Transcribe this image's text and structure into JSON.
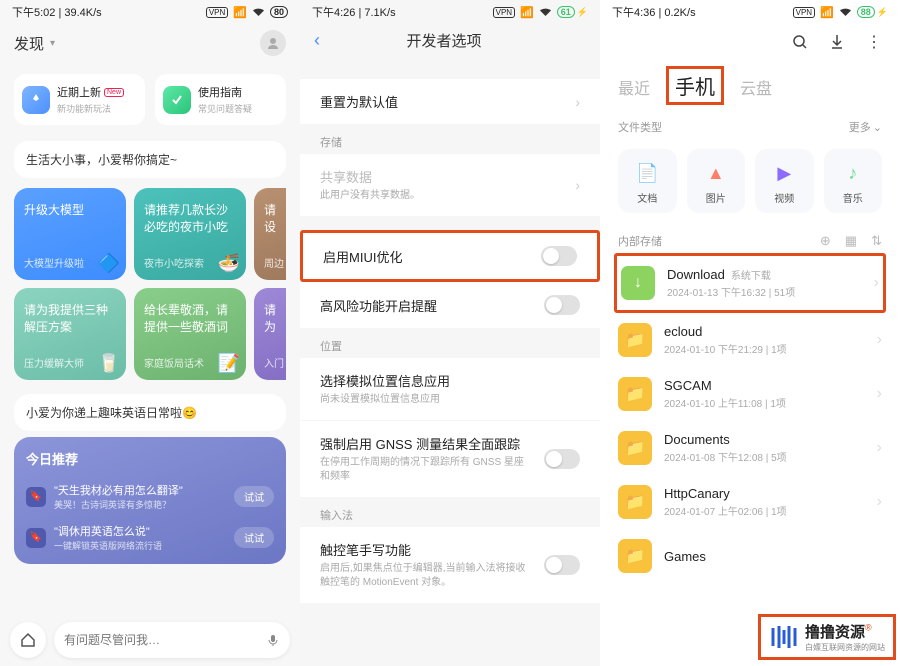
{
  "p1": {
    "status_time": "下午5:02 | 39.4K/s",
    "battery": "80",
    "title": "发现",
    "card_new": {
      "title": "近期上新",
      "badge": "New",
      "sub": "新功能新玩法"
    },
    "card_guide": {
      "title": "使用指南",
      "sub": "常见问题答疑"
    },
    "suggest": "生活大小事，小爱帮你搞定~",
    "tiles": [
      {
        "t": "升级大模型",
        "f": "大模型升级啦"
      },
      {
        "t": "请推荐几款长沙必吃的夜市小吃",
        "f": "夜市小吃探索"
      },
      {
        "t": "请设",
        "f": "周边"
      },
      {
        "t": "请为我提供三种解压方案",
        "f": "压力缓解大师"
      },
      {
        "t": "给长辈敬酒，请提供一些敬酒词",
        "f": "家庭饭局话术"
      },
      {
        "t": "请为",
        "f": "入门"
      }
    ],
    "suggest2": "小爱为你递上趣味英语日常啦😊",
    "today": {
      "h": "今日推荐",
      "rows": [
        {
          "a": "\"天生我材必有用怎么翻译\"",
          "b": "美哭！古诗词英译有多惊艳？",
          "btn": "试试"
        },
        {
          "a": "\"调休用英语怎么说\"",
          "b": "一键解锁英语版网络流行语",
          "btn": "试试"
        }
      ]
    },
    "search_ph": "有问题尽管问我…"
  },
  "p2": {
    "status_time": "下午4:26 | 7.1K/s",
    "battery": "61",
    "title": "开发者选项",
    "reset": "重置为默认值",
    "g_store": "存储",
    "r_share": {
      "a": "共享数据",
      "b": "此用户没有共享数据。"
    },
    "r_miui": "启用MIUI优化",
    "r_risk": "高风险功能开启提醒",
    "g_loc": "位置",
    "r_loc": {
      "a": "选择模拟位置信息应用",
      "b": "尚未设置模拟位置信息应用"
    },
    "r_gnss": {
      "a": "强制启用 GNSS 测量结果全面跟踪",
      "b": "在停用工作周期的情况下跟踪所有 GNSS 星座和频率"
    },
    "g_ime": "输入法",
    "r_pen": {
      "a": "触控笔手写功能",
      "b": "启用后,如果焦点位于编辑器,当前输入法将接收触控笔的 MotionEvent 对象。"
    }
  },
  "p3": {
    "status_time": "下午4:36 | 0.2K/s",
    "battery": "88",
    "tabs": {
      "a": "最近",
      "b": "手机",
      "c": "云盘"
    },
    "ftype_lbl": "文件类型",
    "more": "更多",
    "cats": [
      {
        "l": "文档"
      },
      {
        "l": "图片"
      },
      {
        "l": "视频"
      },
      {
        "l": "音乐"
      }
    ],
    "storage": "内部存储",
    "folders": [
      {
        "n": "Download",
        "sys": "系统下载",
        "d": "2024-01-13 下午16:32 | 51项"
      },
      {
        "n": "ecloud",
        "d": "2024-01-10 下午21:29 | 1项"
      },
      {
        "n": "SGCAM",
        "d": "2024-01-10 上午11:08 | 1项"
      },
      {
        "n": "Documents",
        "d": "2024-01-08 下午12:08 | 5项"
      },
      {
        "n": "HttpCanary",
        "d": "2024-01-07 上午02:06 | 1项"
      },
      {
        "n": "Games",
        "d": ""
      }
    ],
    "wm": {
      "a": "撸撸资源",
      "b": "白嫖互联网资源的网站"
    }
  }
}
